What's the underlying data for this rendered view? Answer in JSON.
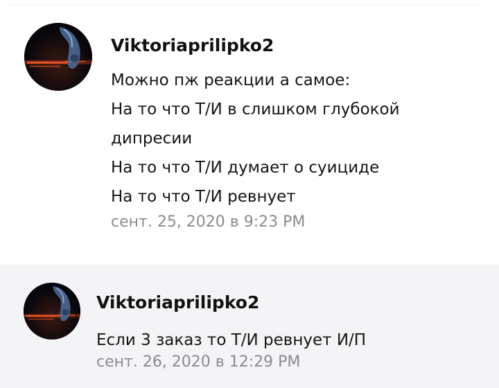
{
  "comments": [
    {
      "avatar_icon": "night-city-avatar-icon",
      "username": "Viktoriaprilipko2",
      "lines": [
        "Можно пж реакции а самое:",
        "На то что Т/И в слишком глубокой",
        "дипресии",
        "На то что Т/И думает о суициде",
        "На то что Т/И ревнует"
      ],
      "timestamp": "сент. 25, 2020 в 9:23 PM"
    },
    {
      "avatar_icon": "night-city-avatar-icon",
      "username": "Viktoriaprilipko2",
      "lines": [
        "Если 3 заказ то Т/И ревнует И/П"
      ],
      "timestamp": "сент. 26, 2020 в 12:29 PM"
    }
  ],
  "colors": {
    "username": "#111111",
    "text": "#141414",
    "timestamp": "#8b8b8f",
    "highlight_bg": "#f4f4f6"
  }
}
